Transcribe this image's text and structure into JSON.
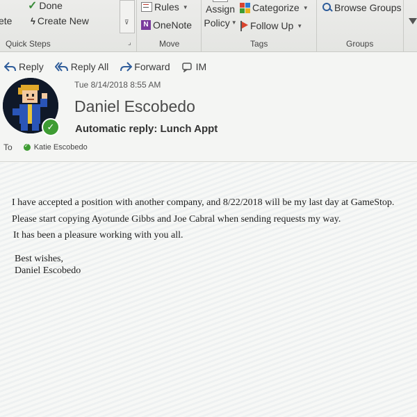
{
  "ribbon": {
    "quick_steps": {
      "items": [
        {
          "label": "Done",
          "icon": "checkmark-icon"
        },
        {
          "label": "Create New",
          "icon": "lightning-icon"
        }
      ],
      "partial_label": "ete",
      "group_label": "Quick Steps"
    },
    "move": {
      "items": [
        {
          "label": "Rules",
          "icon": "rules-icon"
        },
        {
          "label": "OneNote",
          "icon": "onenote-icon"
        }
      ],
      "group_label": "Move"
    },
    "tags": {
      "assign_policy": [
        "Assign",
        "Policy"
      ],
      "items": [
        {
          "label": "Categorize",
          "icon": "categorize-icon"
        },
        {
          "label": "Follow Up",
          "icon": "flag-icon"
        }
      ],
      "group_label": "Tags"
    },
    "groups": {
      "items": [
        {
          "label": "Browse Groups",
          "icon": "search-icon"
        }
      ],
      "group_label": "Groups"
    }
  },
  "actions": [
    {
      "label": "Reply",
      "icon": "reply-icon"
    },
    {
      "label": "Reply All",
      "icon": "reply-all-icon"
    },
    {
      "label": "Forward",
      "icon": "forward-icon"
    },
    {
      "label": "IM",
      "icon": "im-icon"
    }
  ],
  "message": {
    "date": "Tue 8/14/2018 8:55 AM",
    "sender": "Daniel Escobedo",
    "subject": "Automatic reply: Lunch Appt",
    "to_label": "To",
    "recipient": "Katie Escobedo",
    "presence_color": "#3e9c33",
    "body_lines": [
      "I have accepted a position with another company, and 8/22/2018 will be my last day at GameStop.",
      "Please start copying Ayotunde Gibbs and Joe Cabral when sending requests my way.",
      "It has been a pleasure working with you all."
    ],
    "signature": [
      "Best wishes,",
      "Daniel Escobedo"
    ]
  }
}
